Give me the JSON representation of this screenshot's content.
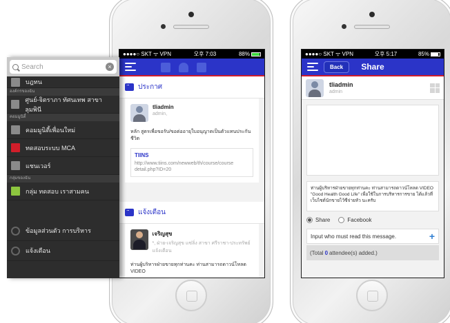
{
  "left_phone": {
    "status": {
      "carrier": "●●●●○ SKT ᯤ VPN",
      "time": "오후 7:03",
      "battery": "88%",
      "battery_level": 0.88
    },
    "sections": {
      "announce_title": "ประกาศ",
      "alert_title": "แจ้งเตือน"
    },
    "post1": {
      "name": "tliadmin",
      "role": "admin,",
      "body": "หลัก สูตรเพื่อขอรับ/ขอต่ออายุใบอนุญาตเป็นตัวแทนประกัน ชีวิต",
      "link_title": "TIINS",
      "link_url": "http://www.tiins.com/newweb/th/course/course detail.php?ID=20"
    },
    "post2": {
      "name": "เจริญสุข",
      "role": "*, ฝ่าย-เจริญสุข แซ่ลิ่ง สาขา ศรีราชา-ประทรัพย์ แจ้งเตือน",
      "body": "ท่านผู้บริหารฝ่ายขายทุกท่านคะ ท่านสามารถดาวน์โหลด VIDEO"
    },
    "side_menu": {
      "search_placeholder": "Search",
      "items": [
        {
          "label": "บฎทน",
          "icon": "image-icon"
        },
        {
          "group": "องค์กรของฉัน"
        },
        {
          "label": "ศูนย์-จิตราภา ทัศนเทพ สาขา ลุมพินี",
          "icon": "building-icon"
        },
        {
          "group": "คอมมูนิตี้"
        },
        {
          "label": "คอมมูนิตี้เพื่อนใหม่",
          "icon": "people-icon"
        },
        {
          "label": "ทดสอบระบบ MCA",
          "icon": "gift-icon"
        },
        {
          "label": "แชนเวอร์",
          "icon": "people-icon"
        },
        {
          "group": "กลุ่มของฉัน"
        },
        {
          "label": "กลุ่ม ทดสอบ เราสามคน",
          "icon": "group-icon"
        }
      ],
      "bottom_items": [
        {
          "label": "ข้อมูลส่วนตัว การบริหาร",
          "icon": "gear-icon"
        },
        {
          "label": "แจ้งเตือน",
          "icon": "clock-icon"
        }
      ]
    }
  },
  "right_phone": {
    "status": {
      "carrier": "●●●●○ SKT ᯤ VPN",
      "time": "오후 5:17",
      "battery": "85%",
      "battery_level": 0.85
    },
    "nav": {
      "back_label": "Back",
      "title": "Share"
    },
    "user": {
      "name": "tliadmin",
      "role": "admin"
    },
    "share_text": "ท่านผู้บริหารฝ่ายขายทุกท่านคะ ท่านสามารถดาวน์โหลด VIDEO \"Good Health Good Life\" เพื่อใช้ในการบริหารการขาย ได้แล้วที่ เว็บไซต์นักขายไว้ซีจ่ายหัว นะครับ",
    "radios": {
      "share": "Share",
      "facebook": "Facebook"
    },
    "must_read": "Input who must read this message.",
    "attendees_prefix": "(Total",
    "attendees_count": "0",
    "attendees_suffix": "attendee(s) added.)"
  },
  "colors": {
    "brand_blue": "#2b34c8",
    "accent_red": "#d01b2b",
    "link_blue": "#2e7dd1"
  }
}
